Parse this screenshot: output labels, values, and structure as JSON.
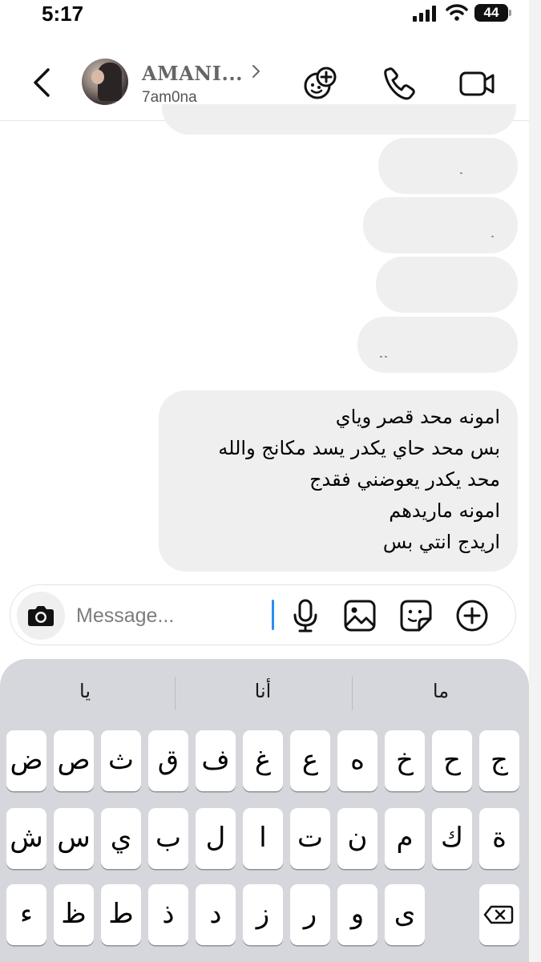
{
  "status_bar": {
    "time": "5:17",
    "battery": "44"
  },
  "header": {
    "contact_name": "AMANI...",
    "username": "7am0na",
    "icons": [
      "back-icon",
      "games-icon",
      "phone-icon",
      "video-camera-icon"
    ]
  },
  "messages": {
    "main_lines": [
      "امونه محد قصر وياي",
      "بس محد حاي يكدر يسد مكانج والله",
      "محد يكدر يعوضني فقدج",
      "امونه ماريدهم",
      "اريدج انتي بس"
    ]
  },
  "composer": {
    "placeholder": "Message...",
    "icons": [
      "camera-icon",
      "microphone-icon",
      "gallery-icon",
      "sticker-icon",
      "plus-icon"
    ]
  },
  "keyboard": {
    "suggestions": [
      "يا",
      "أنا",
      "ما"
    ],
    "row1": [
      "ض",
      "ص",
      "ث",
      "ق",
      "ف",
      "غ",
      "ع",
      "ه",
      "خ",
      "ح",
      "ج"
    ],
    "row2": [
      "ش",
      "س",
      "ي",
      "ب",
      "ل",
      "ا",
      "ت",
      "ن",
      "م",
      "ك",
      "ة"
    ],
    "row3": [
      "ء",
      "ظ",
      "ط",
      "ذ",
      "د",
      "ز",
      "ر",
      "و",
      "ى"
    ]
  },
  "colors": {
    "bubble": "#efefef",
    "keyboard_bg": "#d5d7dc",
    "caret": "#2a8ef0"
  }
}
